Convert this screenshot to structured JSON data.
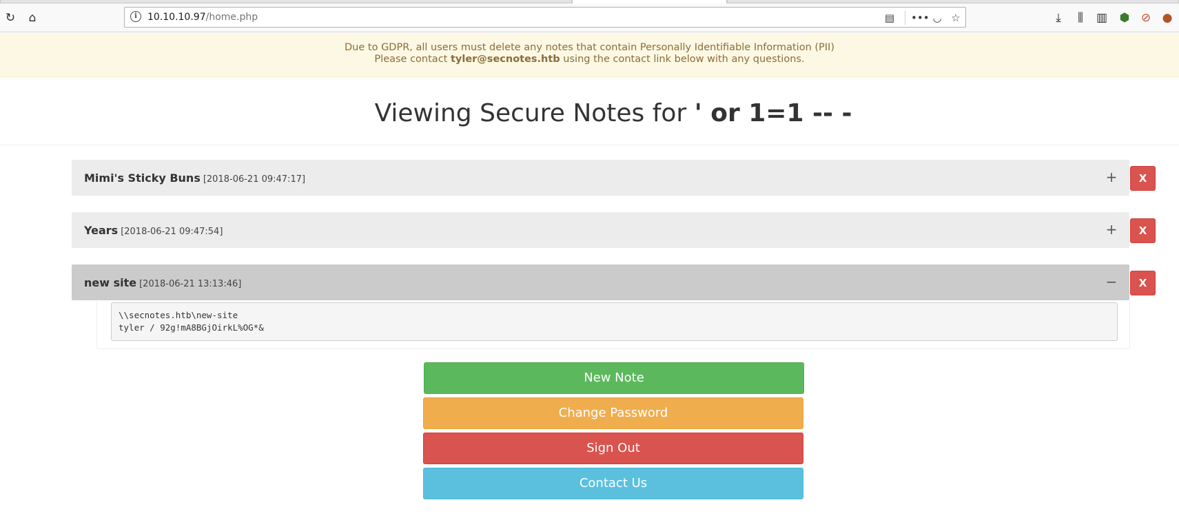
{
  "browser": {
    "url_host": "10.10.10.97",
    "url_path": "/home.php"
  },
  "banner": {
    "line1": "Due to GDPR, all users must delete any notes that contain Personally Identifiable Information (PII)",
    "line2_prefix": "Please contact ",
    "line2_email": "tyler@secnotes.htb",
    "line2_suffix": " using the contact link below with any questions."
  },
  "heading": {
    "prefix": "Viewing Secure Notes for ",
    "username": "' or 1=1 -- -"
  },
  "notes": [
    {
      "title": "Mimi's Sticky Buns",
      "date": "[2018-06-21 09:47:17]",
      "toggle": "+",
      "delete": "X"
    },
    {
      "title": "Years",
      "date": "[2018-06-21 09:47:54]",
      "toggle": "+",
      "delete": "X"
    },
    {
      "title": "new site",
      "date": "[2018-06-21 13:13:46]",
      "toggle": "−",
      "delete": "X",
      "body": "\\\\secnotes.htb\\new-site\ntyler / 92g!mA8BGjOirkL%OG*&"
    }
  ],
  "actions": {
    "new_note": "New Note",
    "change_password": "Change Password",
    "sign_out": "Sign Out",
    "contact_us": "Contact Us"
  },
  "colors": {
    "banner_bg": "#fcf8e3",
    "banner_text": "#8a6d3b",
    "danger": "#d9534f",
    "success": "#5cb85c",
    "warning": "#f0ad4e",
    "info": "#5bc0de"
  }
}
